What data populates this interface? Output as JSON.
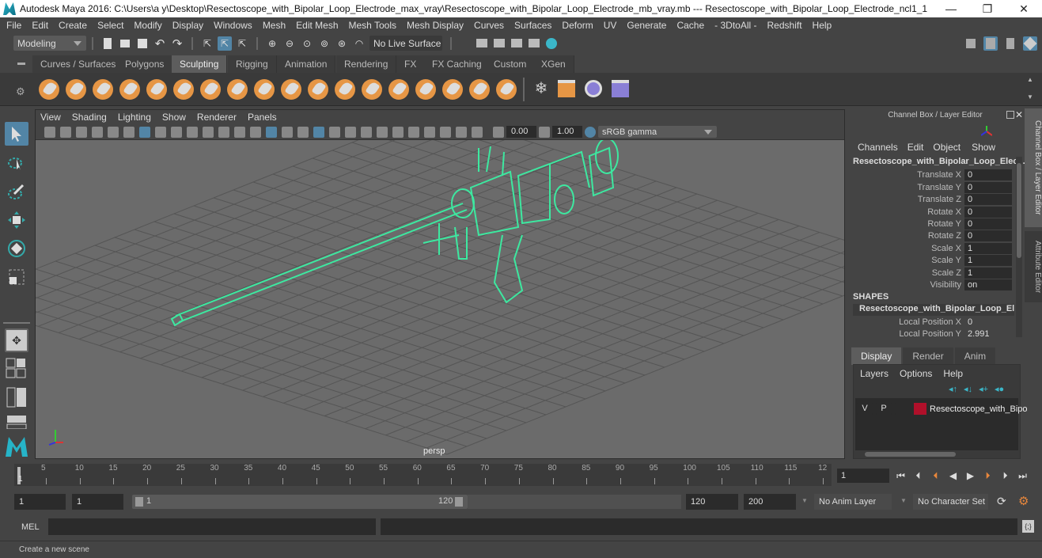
{
  "window": {
    "title": "Autodesk Maya 2016: C:\\Users\\a y\\Desktop\\Resectoscope_with_Bipolar_Loop_Electrode_max_vray\\Resectoscope_with_Bipolar_Loop_Electrode_mb_vray.mb  ---  Resectoscope_with_Bipolar_Loop_Electrode_ncl1_1",
    "minimize": "—",
    "maximize": "❐",
    "close": "✕"
  },
  "menubar": [
    "File",
    "Edit",
    "Create",
    "Select",
    "Modify",
    "Display",
    "Windows",
    "Mesh",
    "Edit Mesh",
    "Mesh Tools",
    "Mesh Display",
    "Curves",
    "Surfaces",
    "Deform",
    "UV",
    "Generate",
    "Cache",
    "- 3DtoAll -",
    "Redshift",
    "Help"
  ],
  "statusline": {
    "mode": "Modeling",
    "live_surface": "No Live Surface"
  },
  "shelf": {
    "tabs": [
      "Curves / Surfaces",
      "Polygons",
      "Sculpting",
      "Rigging",
      "Animation",
      "Rendering",
      "FX",
      "FX Caching",
      "Custom",
      "XGen"
    ],
    "active_tab": "Sculpting",
    "tools": [
      "sculpt",
      "smooth",
      "relax",
      "grab",
      "pinch",
      "flatten",
      "foamy",
      "spray",
      "repeat",
      "imprint",
      "wax",
      "scrape",
      "fill",
      "knife",
      "smear",
      "bulge",
      "amplify",
      "freeze"
    ]
  },
  "viewport": {
    "menu": [
      "View",
      "Shading",
      "Lighting",
      "Show",
      "Renderer",
      "Panels"
    ],
    "exposure": "0.00",
    "gamma": "1.00",
    "color_space": "sRGB gamma",
    "camera": "persp",
    "wire_color": "#3de8a0"
  },
  "channel_box": {
    "header": "Channel Box / Layer Editor",
    "menu": [
      "Channels",
      "Edit",
      "Object",
      "Show"
    ],
    "object": "Resectoscope_with_Bipolar_Loop_Elec...",
    "channels": [
      {
        "label": "Translate X",
        "value": "0"
      },
      {
        "label": "Translate Y",
        "value": "0"
      },
      {
        "label": "Translate Z",
        "value": "0"
      },
      {
        "label": "Rotate X",
        "value": "0"
      },
      {
        "label": "Rotate Y",
        "value": "0"
      },
      {
        "label": "Rotate Z",
        "value": "0"
      },
      {
        "label": "Scale X",
        "value": "1"
      },
      {
        "label": "Scale Y",
        "value": "1"
      },
      {
        "label": "Scale Z",
        "value": "1"
      },
      {
        "label": "Visibility",
        "value": "on"
      }
    ],
    "shapes_header": "SHAPES",
    "shape_name": "Resectoscope_with_Bipolar_Loop_El...",
    "shape_channels": [
      {
        "label": "Local Position X",
        "value": "0"
      },
      {
        "label": "Local Position Y",
        "value": "2.991"
      }
    ]
  },
  "layer_editor": {
    "tabs": [
      "Display",
      "Render",
      "Anim"
    ],
    "active_tab": "Display",
    "menu": [
      "Layers",
      "Options",
      "Help"
    ],
    "layer": {
      "v": "V",
      "p": "P",
      "name": "Resectoscope_with_Bipo",
      "color": "#b0102a"
    }
  },
  "side_tabs": [
    "Channel Box / Layer Editor",
    "Attribute Editor"
  ],
  "timeline": {
    "ticks": [
      "5",
      "10",
      "15",
      "20",
      "25",
      "30",
      "35",
      "40",
      "45",
      "50",
      "55",
      "60",
      "65",
      "70",
      "75",
      "80",
      "85",
      "90",
      "95",
      "100",
      "105",
      "110",
      "115",
      "12"
    ],
    "current_marker": "1",
    "current_frame": "1"
  },
  "range": {
    "start": "1",
    "anim_start": "1",
    "slider_start": "1",
    "slider_end": "120",
    "end": "120",
    "anim_end": "200",
    "anim_layer": "No Anim Layer",
    "character_set": "No Character Set"
  },
  "command_line": {
    "label": "MEL"
  },
  "help_line": "Create a new scene"
}
